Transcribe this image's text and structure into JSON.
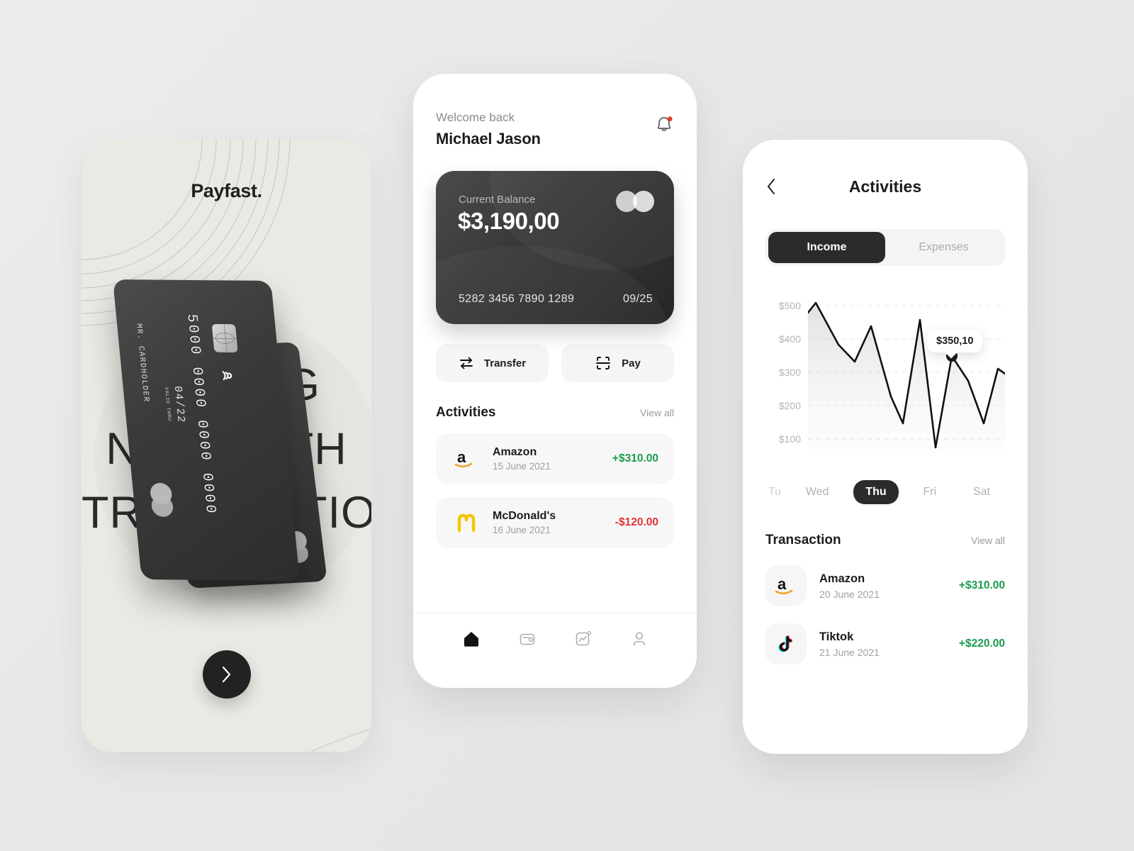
{
  "left_panel": {
    "brand": "Payfast.",
    "background_headline": "COMING\nNOW WITH\nTRANSACTION",
    "next_label": "next-arrow",
    "card": {
      "holder": "MR. CARDHOLDER",
      "valid_label": "VALID\nTHRU",
      "expiry": "04/22",
      "number": "5000 0000 0000 0000"
    }
  },
  "home": {
    "greeting": "Welcome back",
    "user_name": "Michael Jason",
    "notification_icon": "bell-icon",
    "balance_card": {
      "label": "Current Balance",
      "amount": "$3,190,00",
      "card_number": "5282 3456 7890 1289",
      "expiry": "09/25",
      "brand_logo": "mastercard-logo"
    },
    "actions": [
      {
        "label": "Transfer",
        "icon": "transfer-arrows-icon"
      },
      {
        "label": "Pay",
        "icon": "scan-pay-icon"
      }
    ],
    "activities": {
      "title": "Activities",
      "view_all": "View all",
      "rows": [
        {
          "merchant": "Amazon",
          "date": "15 June 2021",
          "amount": "+$310.00",
          "sign": "pos",
          "logo": "amazon-logo"
        },
        {
          "merchant": "McDonald's",
          "date": "16 June 2021",
          "amount": "-$120.00",
          "sign": "neg",
          "logo": "mcdonalds-logo"
        }
      ]
    },
    "tabbar": [
      {
        "icon": "home-icon",
        "active": true
      },
      {
        "icon": "wallet-icon",
        "active": false
      },
      {
        "icon": "stats-icon",
        "active": false
      },
      {
        "icon": "profile-icon",
        "active": false
      }
    ]
  },
  "activities_screen": {
    "back_icon": "chevron-left-icon",
    "title": "Activities",
    "segments": [
      {
        "label": "Income",
        "active": true
      },
      {
        "label": "Expenses",
        "active": false
      }
    ],
    "tooltip_value": "$350,10",
    "days": [
      {
        "label": "Tue",
        "active": false,
        "clipped": true
      },
      {
        "label": "Wed",
        "active": false,
        "clipped": false
      },
      {
        "label": "Thu",
        "active": true,
        "clipped": false
      },
      {
        "label": "Fri",
        "active": false,
        "clipped": false
      },
      {
        "label": "Sat",
        "active": false,
        "clipped": false
      }
    ],
    "transaction": {
      "title": "Transaction",
      "view_all": "View all",
      "rows": [
        {
          "merchant": "Amazon",
          "date": "20 June 2021",
          "amount": "+$310.00",
          "sign": "pos",
          "logo": "amazon-logo"
        },
        {
          "merchant": "Tiktok",
          "date": "21 June 2021",
          "amount": "+$220.00",
          "sign": "pos",
          "logo": "tiktok-logo"
        }
      ]
    }
  },
  "chart_data": {
    "type": "line",
    "title": "Income",
    "xlabel": "",
    "ylabel": "",
    "ylim": [
      0,
      560
    ],
    "yticks": [
      100,
      200,
      300,
      400,
      500
    ],
    "ytick_labels": [
      "$100",
      "$200",
      "$300",
      "$400",
      "$500"
    ],
    "grid": true,
    "legend": false,
    "x_categories": [
      "Tue",
      "Wed",
      "Thu",
      "Fri",
      "Sat"
    ],
    "area_fill": true,
    "highlight_point": {
      "index": 10,
      "value": 350.1,
      "label": "$350,10"
    },
    "values": [
      480,
      510,
      385,
      335,
      450,
      240,
      160,
      390,
      40,
      350,
      275,
      160,
      290
    ]
  },
  "colors": {
    "page_bg": "#e9e9e9",
    "panel_bg": "#eaeae4",
    "dark": "#2b2b2b",
    "positive": "#1a9b4e",
    "negative": "#e03333",
    "muted": "#a0a0a0"
  }
}
